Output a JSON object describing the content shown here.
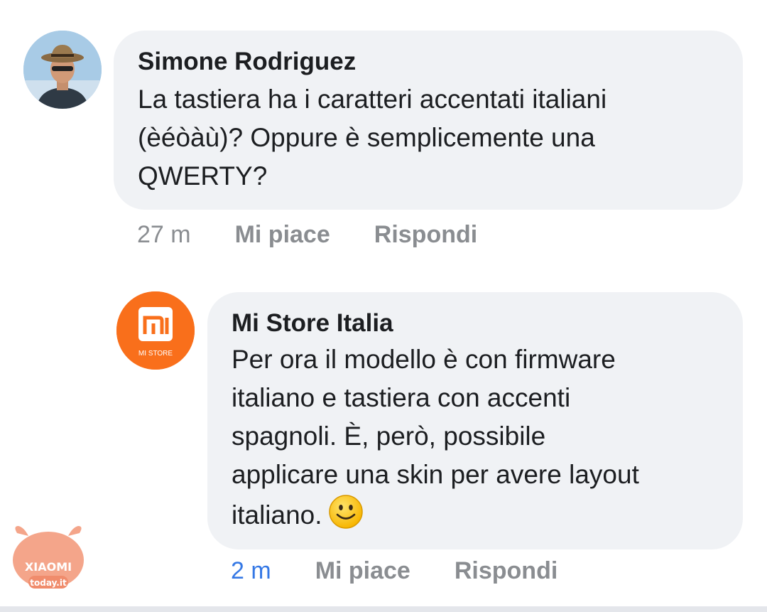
{
  "comments": [
    {
      "author": "Simone Rodriguez",
      "text": "La tastiera ha i caratteri accentati italiani\n(èéòàù)? Oppure è semplicemente una\nQWERTY?",
      "time": "27 m",
      "like_label": "Mi piace",
      "reply_label": "Rispondi"
    },
    {
      "author": "Mi Store Italia",
      "avatar_label": "MI STORE",
      "text": "Per ora il modello è con firmware\nitaliano e tastiera con accenti\nspagnoli. È, però, possibile\napplicare una skin per avere layout\nitaliano.",
      "emoji": "smiling-face-icon",
      "time": "2 m",
      "like_label": "Mi piace",
      "reply_label": "Rispondi"
    }
  ],
  "watermark": {
    "brand": "XIAOMI",
    "site": "today.it"
  },
  "colors": {
    "bubble": "#f0f2f5",
    "meta_gray": "#8a8d91",
    "time_recent": "#3578e5",
    "mi_orange": "#f96f1b"
  }
}
